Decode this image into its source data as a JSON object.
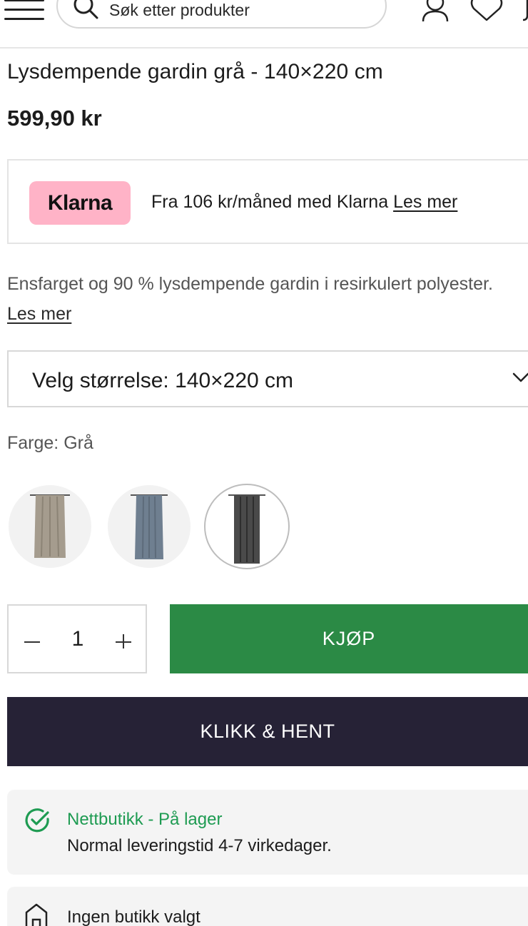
{
  "header": {
    "search_placeholder": "Søk etter produkter",
    "icons": [
      "menu-icon",
      "search-icon",
      "user-icon",
      "heart-icon",
      "cart-icon"
    ]
  },
  "product": {
    "title": "Lysdempende gardin grå - 140×220 cm",
    "price": "599,90 kr",
    "description": "Ensfarget og 90 % lysdempende gardin i resirkulert polyester.",
    "description_link": "Les mer"
  },
  "klarna": {
    "logo_text": "Klarna",
    "text": "Fra 106 kr/måned med Klarna",
    "link": "Les mer",
    "brand_color": "#ffb3c7"
  },
  "size_select": {
    "label": "Velg størrelse: 140×220 cm"
  },
  "color": {
    "label": "Farge:",
    "value": "Grå",
    "swatches": [
      {
        "name": "Beige",
        "color": "#a59c8e",
        "selected": false
      },
      {
        "name": "Blå",
        "color": "#6f7f90",
        "selected": false
      },
      {
        "name": "Grå",
        "color": "#4a4a4a",
        "selected": true
      }
    ]
  },
  "quantity": {
    "value": "1"
  },
  "buttons": {
    "buy_label": "KJØP",
    "buy_color": "#2b8a45",
    "pickup_label": "KLIKK & HENT",
    "pickup_color": "#262236"
  },
  "stock": {
    "title": "Nettbutikk - På lager",
    "subtitle": "Normal leveringstid 4-7 virkedager.",
    "status_color": "#1e9b52"
  },
  "store": {
    "text": "Ingen butikk valgt"
  }
}
